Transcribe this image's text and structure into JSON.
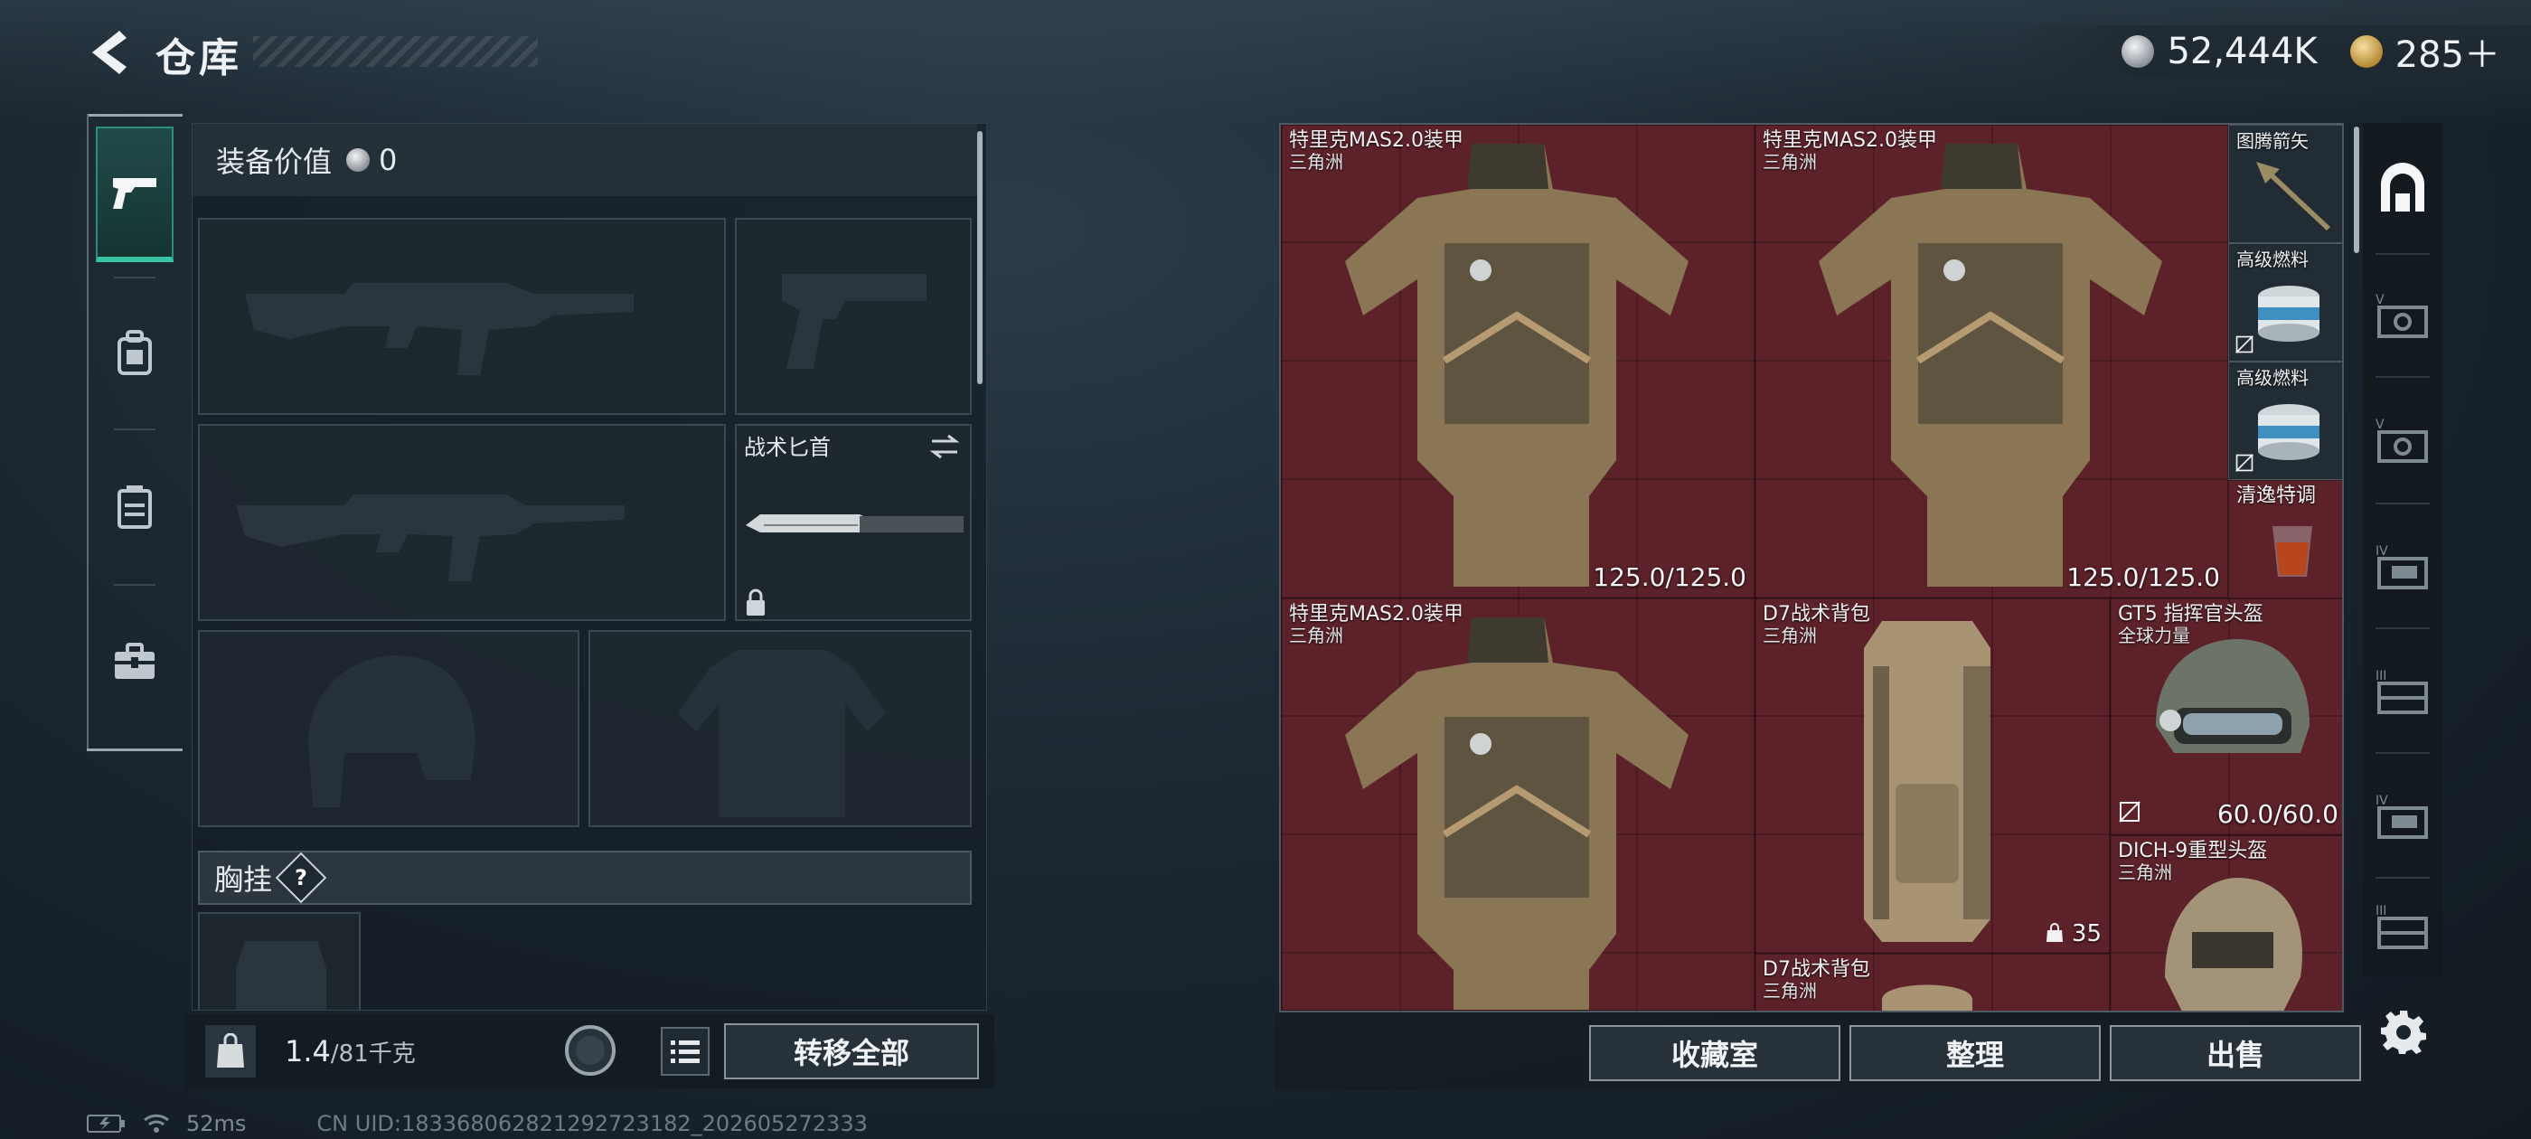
{
  "header": {
    "title": "仓库",
    "currency": [
      {
        "icon": "silver-coin-icon",
        "value": "52,444K"
      },
      {
        "icon": "gold-coin-icon",
        "value": "285＋"
      }
    ]
  },
  "left_tabs": [
    {
      "name": "weapons",
      "icon": "pistol-icon",
      "active": true
    },
    {
      "name": "armor",
      "icon": "backpack-armor-icon"
    },
    {
      "name": "container",
      "icon": "rig-icon"
    },
    {
      "name": "case",
      "icon": "briefcase-icon"
    }
  ],
  "loadout": {
    "value_label": "装备价值",
    "value_amount": "0",
    "knife_name": "战术匕首",
    "vest_label": "胸挂",
    "vest_help": "?"
  },
  "weight": {
    "current": "1.4",
    "max": "/81千克"
  },
  "actions": {
    "transfer_all": "转移全部",
    "collection": "收藏室",
    "sort": "整理",
    "sell": "出售"
  },
  "stash_items": [
    {
      "name": "特里克MAS2.0装甲",
      "sub": "三角洲",
      "durability": "125.0/125.0"
    },
    {
      "name": "特里克MAS2.0装甲",
      "sub": "三角洲",
      "durability": "125.0/125.0"
    },
    {
      "name": "特里克MAS2.0装甲",
      "sub": "三角洲",
      "durability": ""
    },
    {
      "name": "D7战术背包",
      "sub": "三角洲",
      "capacity": "35"
    },
    {
      "name": "GT5 指挥官头盔",
      "sub": "全球力量",
      "durability": "60.0/60.0"
    },
    {
      "name": "DICH-9重型头盔",
      "sub": "三角洲"
    },
    {
      "name": "D7战术背包",
      "sub": "三角洲"
    },
    {
      "name": "图腾箭矢"
    },
    {
      "name": "高级燃料"
    },
    {
      "name": "高级燃料"
    },
    {
      "name": "清逸特调"
    }
  ],
  "status_bar": {
    "ping": "52ms",
    "uid": "CN UID:1833680628212927231​82_202605272333"
  },
  "colors": {
    "grid_bg": "#5d2229",
    "accent_teal": "#36c4a2",
    "panel": "#1b252d"
  }
}
